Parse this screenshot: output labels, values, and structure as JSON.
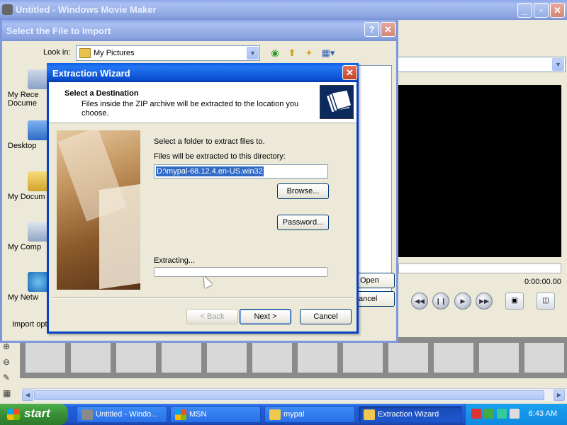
{
  "movie_maker": {
    "title": "Untitled - Windows Movie Maker",
    "time_display": "0:00:00.00"
  },
  "import_dialog": {
    "title": "Select the File to Import",
    "look_in_label": "Look in:",
    "look_in_value": "My Pictures",
    "places": [
      "My Rece Docume",
      "Desktop",
      "My Docum",
      "My Comp",
      "My Netw"
    ],
    "open_label": "Open",
    "cancel_label": "ancel",
    "import_options": "Import optio"
  },
  "wizard": {
    "title": "Extraction Wizard",
    "heading": "Select a Destination",
    "subheading": "Files inside the ZIP archive will be extracted to the location you choose.",
    "select_label": "Select a folder to extract files to.",
    "directory_label": "Files will be extracted to this directory:",
    "directory_value": "D:\\mypal-68.12.4.en-US.win32",
    "browse_label": "Browse...",
    "password_label": "Password...",
    "extracting_label": "Extracting...",
    "progress_fraction": 0,
    "back_label": "< Back",
    "next_label": "Next >",
    "cancel_label": "Cancel"
  },
  "taskbar": {
    "start_label": "start",
    "tasks": [
      {
        "label": "Untitled - Windo...",
        "icon": "movie-maker-icon",
        "active": false
      },
      {
        "label": "MSN",
        "icon": "msn-icon",
        "active": false
      },
      {
        "label": "mypal",
        "icon": "folder-icon",
        "active": false
      },
      {
        "label": "Extraction Wizard",
        "icon": "folder-icon",
        "active": true
      }
    ],
    "clock": "6:43 AM"
  },
  "colors": {
    "titlebar_active": "#0a5fe3",
    "titlebar_inactive": "#8da7e8",
    "taskbar": "#245edb",
    "start_button": "#388e35",
    "selection": "#316ac5"
  }
}
